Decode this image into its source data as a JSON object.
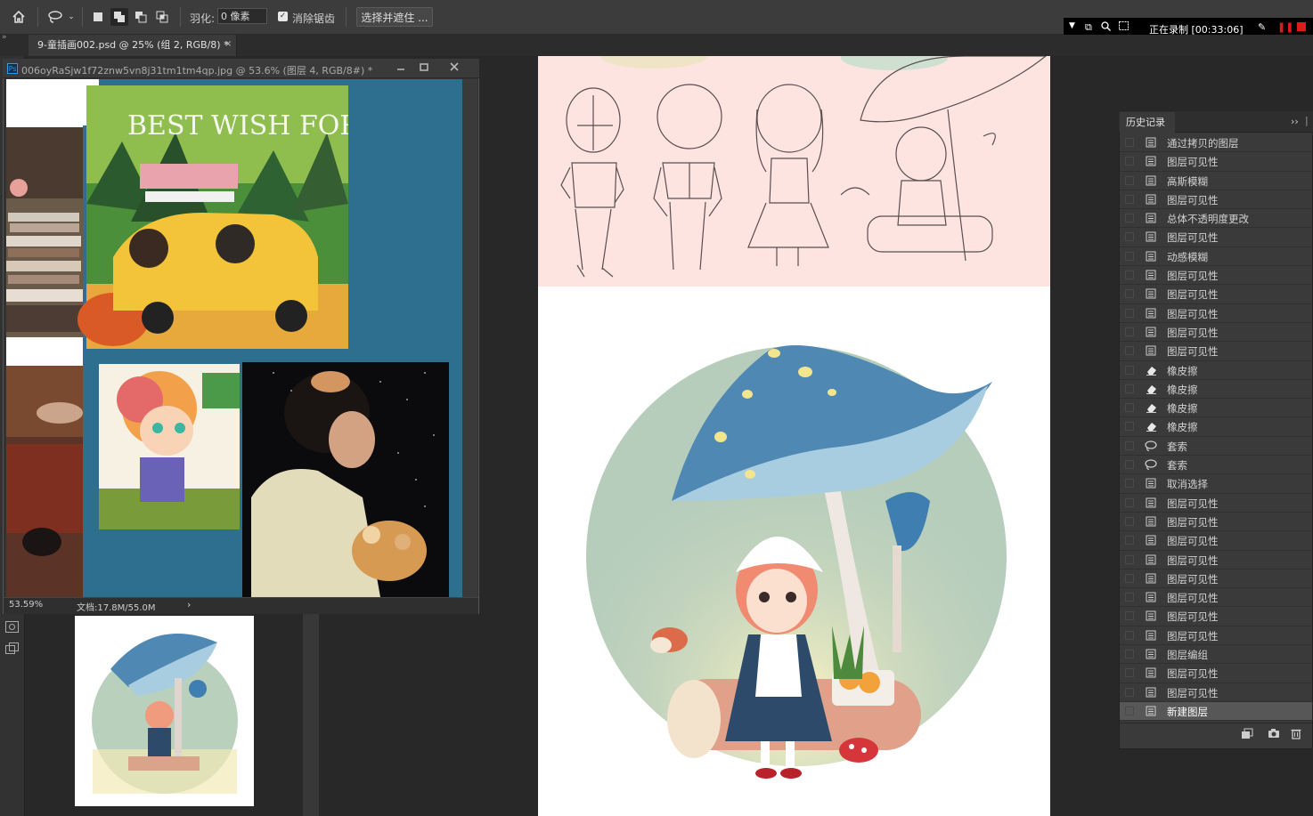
{
  "options_bar": {
    "feather_label": "羽化:",
    "feather_value": "0 像素",
    "antialias_label": "消除锯齿",
    "antialias_checked": true,
    "select_mask_label": "选择并遮住 ..."
  },
  "recording": {
    "status": "正在录制 [00:33:06]"
  },
  "document_tab": {
    "title": "9-童插画002.psd @ 25% (组 2, RGB/8) *",
    "close": "×"
  },
  "floating_window": {
    "title": "006oyRaSjw1f72znw5vn8j31tm1tm4qp.jpg @ 53.6% (图层 4, RGB/8#) *",
    "zoom": "53.59%",
    "doc_info": "文档:17.8M/55.0M",
    "arrow": "›",
    "artwork_text": "BEST WISH FOR YOU"
  },
  "history_panel": {
    "title": "历史记录",
    "collapse": "››",
    "items": [
      {
        "label": "通过拷贝的图层",
        "icon": "document-icon"
      },
      {
        "label": "图层可见性",
        "icon": "document-icon"
      },
      {
        "label": "高斯模糊",
        "icon": "document-icon"
      },
      {
        "label": "图层可见性",
        "icon": "document-icon"
      },
      {
        "label": "总体不透明度更改",
        "icon": "document-icon"
      },
      {
        "label": "图层可见性",
        "icon": "document-icon"
      },
      {
        "label": "动感模糊",
        "icon": "document-icon"
      },
      {
        "label": "图层可见性",
        "icon": "document-icon"
      },
      {
        "label": "图层可见性",
        "icon": "document-icon"
      },
      {
        "label": "图层可见性",
        "icon": "document-icon"
      },
      {
        "label": "图层可见性",
        "icon": "document-icon"
      },
      {
        "label": "图层可见性",
        "icon": "document-icon"
      },
      {
        "label": "橡皮擦",
        "icon": "eraser-icon"
      },
      {
        "label": "橡皮擦",
        "icon": "eraser-icon"
      },
      {
        "label": "橡皮擦",
        "icon": "eraser-icon"
      },
      {
        "label": "橡皮擦",
        "icon": "eraser-icon"
      },
      {
        "label": "套索",
        "icon": "lasso-icon"
      },
      {
        "label": "套索",
        "icon": "lasso-icon"
      },
      {
        "label": "取消选择",
        "icon": "document-icon"
      },
      {
        "label": "图层可见性",
        "icon": "document-icon"
      },
      {
        "label": "图层可见性",
        "icon": "document-icon"
      },
      {
        "label": "图层可见性",
        "icon": "document-icon"
      },
      {
        "label": "图层可见性",
        "icon": "document-icon"
      },
      {
        "label": "图层可见性",
        "icon": "document-icon"
      },
      {
        "label": "图层可见性",
        "icon": "document-icon"
      },
      {
        "label": "图层可见性",
        "icon": "document-icon"
      },
      {
        "label": "图层可见性",
        "icon": "document-icon"
      },
      {
        "label": "图层编组",
        "icon": "document-icon"
      },
      {
        "label": "图层可见性",
        "icon": "document-icon"
      },
      {
        "label": "图层可见性",
        "icon": "document-icon"
      },
      {
        "label": "新建图层",
        "icon": "document-icon",
        "selected": true
      }
    ]
  },
  "colors": {
    "accent": "#2f9de4",
    "canvas_pink": "#fde4e1",
    "mushroom_blue": "#4f88b3",
    "recording_red": "#e01a1a"
  }
}
